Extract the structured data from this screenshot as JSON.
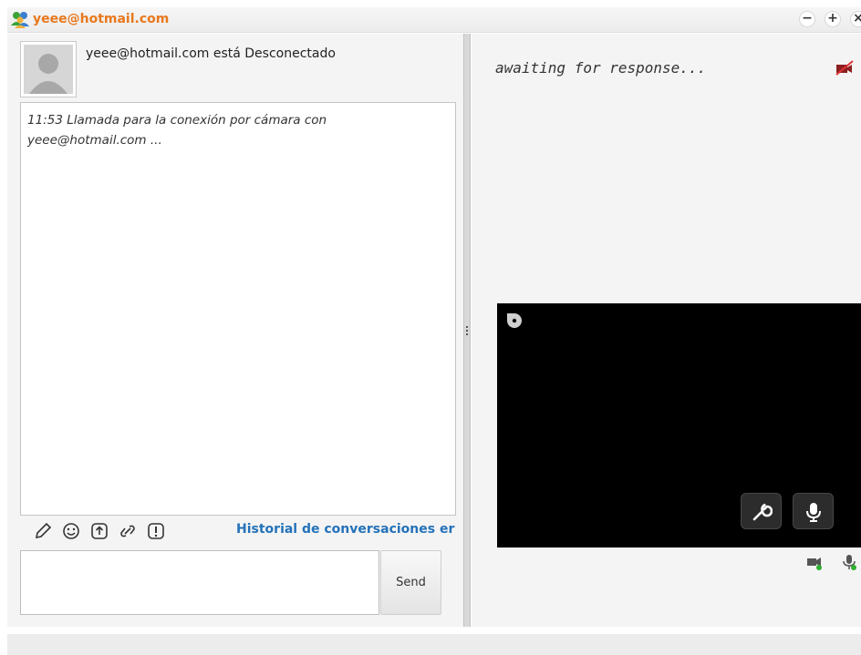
{
  "window": {
    "title": "yeee@hotmail.com",
    "controls": {
      "minimize": "−",
      "maximize": "+",
      "close": "×"
    },
    "accent_color": "#e8781e"
  },
  "contact": {
    "status_text": "yeee@hotmail.com está Desconectado"
  },
  "chat_log": {
    "entries": [
      "11:53 Llamada para la conexión por cámara con yeee@hotmail.com ..."
    ]
  },
  "toolbar": {
    "icons": [
      "pencil-icon",
      "smiley-icon",
      "upload-icon",
      "link-icon",
      "alert-icon"
    ],
    "history_link": "Historial de conversaciones er",
    "link_color": "#2472b9"
  },
  "compose": {
    "value": "",
    "send_label": "Send"
  },
  "video": {
    "status_text": "awaiting for response...",
    "buttons": [
      "wrench-icon",
      "microphone-icon"
    ],
    "indicators": [
      "video-camera-icon",
      "microphone-icon"
    ]
  }
}
